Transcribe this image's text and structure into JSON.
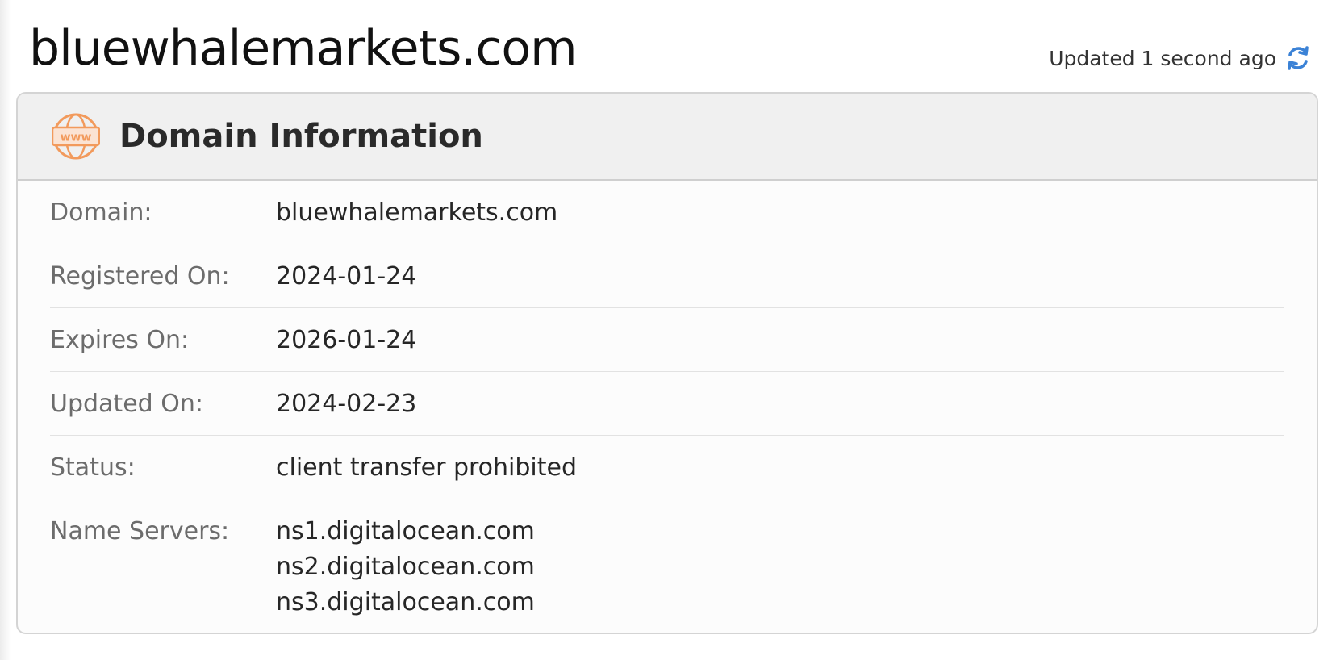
{
  "page": {
    "title": "bluewhalemarkets.com",
    "updated_text": "Updated 1 second ago"
  },
  "card": {
    "title": "Domain Information",
    "icon_text": "www",
    "rows": {
      "domain": {
        "label": "Domain:",
        "value": "bluewhalemarkets.com"
      },
      "registered": {
        "label": "Registered On:",
        "value": "2024-01-24"
      },
      "expires": {
        "label": "Expires On:",
        "value": "2026-01-24"
      },
      "updated": {
        "label": "Updated On:",
        "value": "2024-02-23"
      },
      "status": {
        "label": "Status:",
        "value": "client transfer prohibited"
      },
      "name_servers": {
        "label": "Name Servers:",
        "values": [
          "ns1.digitalocean.com",
          "ns2.digitalocean.com",
          "ns3.digitalocean.com"
        ]
      }
    }
  },
  "icons": {
    "refresh": "refresh-icon",
    "domain": "www-globe-icon"
  },
  "colors": {
    "accent_blue": "#3b82d6",
    "icon_orange": "#f29a5c",
    "header_bg": "#f0f0f0",
    "label_gray": "#6c6c6c"
  }
}
